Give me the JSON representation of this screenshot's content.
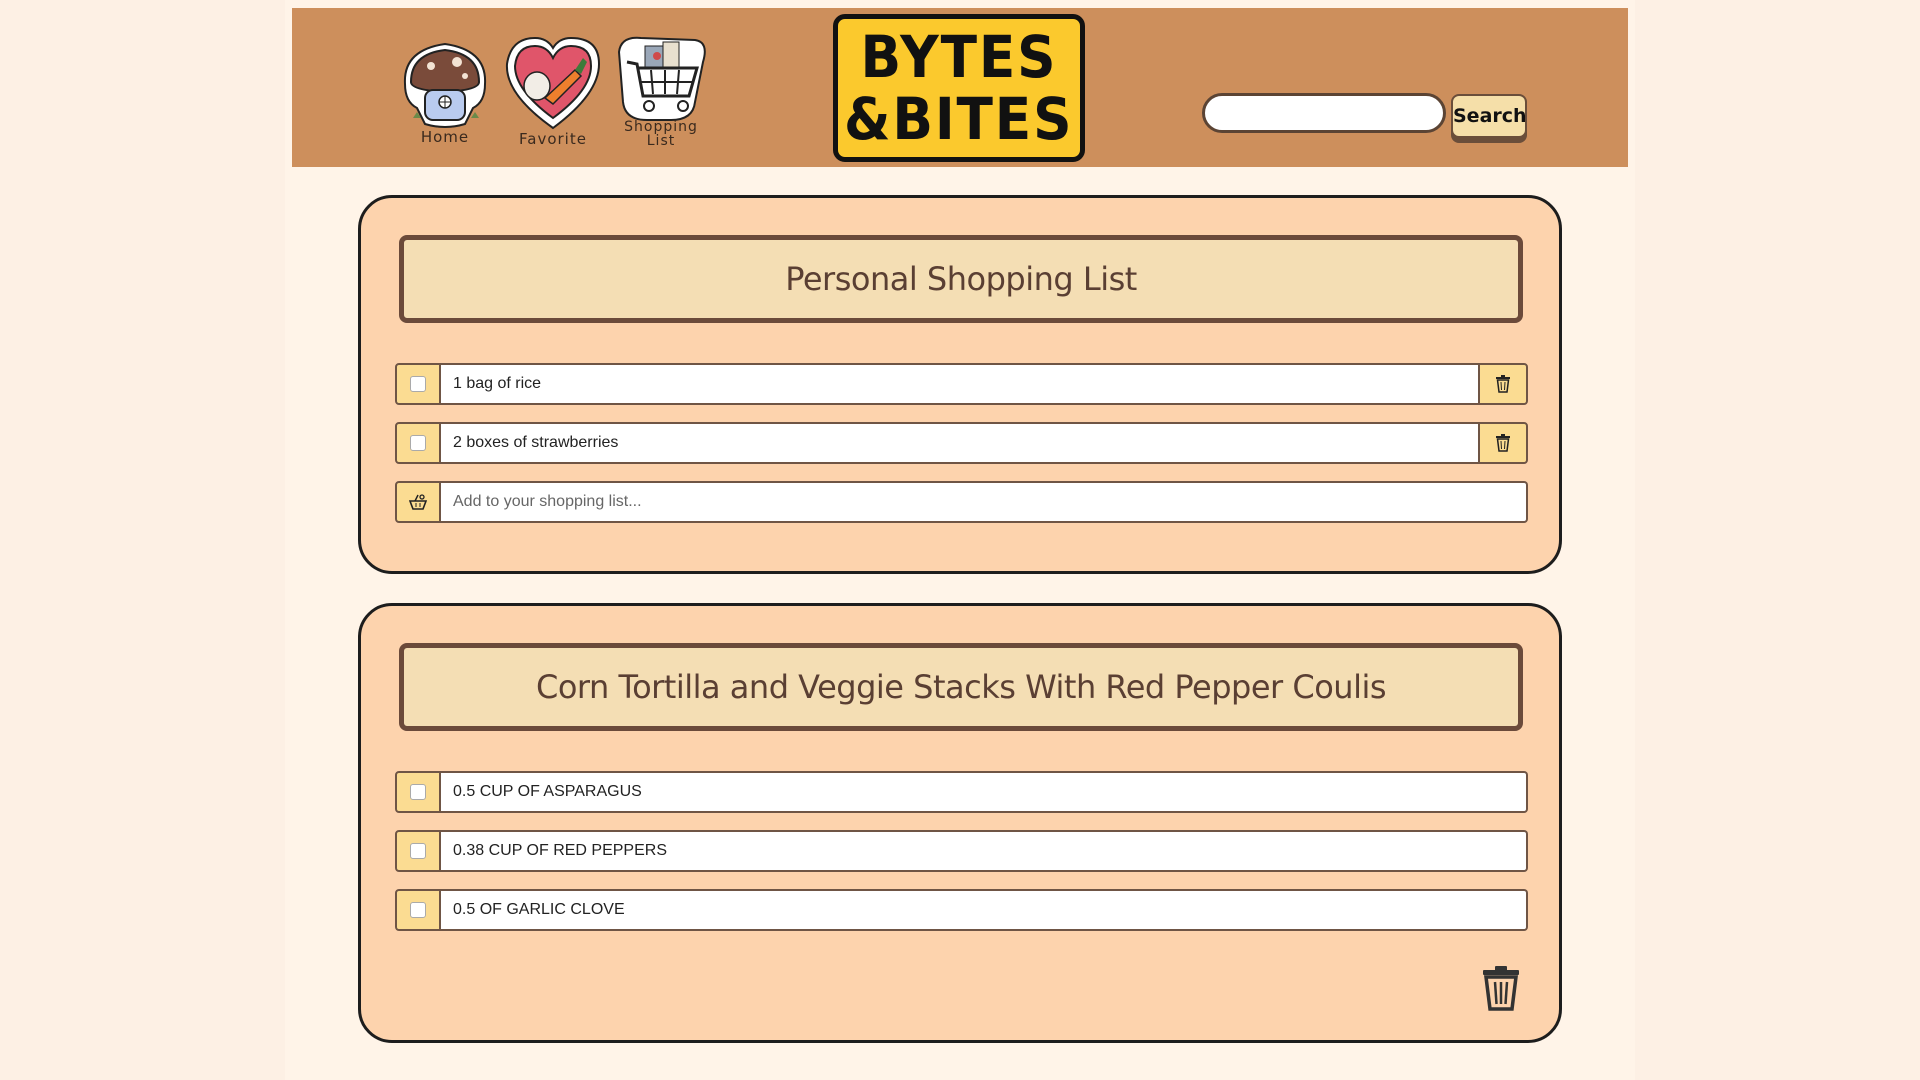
{
  "nav": {
    "home_label": "Home",
    "favorite_label": "Favorite",
    "shopping_label_line1": "Shopping",
    "shopping_label_line2": "List"
  },
  "logo": {
    "line1": "BYTES",
    "line2": "&BITES"
  },
  "search": {
    "value": "",
    "button_label": "Search"
  },
  "personal_list": {
    "title": "Personal Shopping List",
    "items": [
      {
        "text": "1 bag of rice",
        "checked": false
      },
      {
        "text": "2 boxes of strawberries",
        "checked": false
      }
    ],
    "add_placeholder": "Add to your shopping list..."
  },
  "recipe_list": {
    "title": "Corn Tortilla and Veggie Stacks With Red Pepper Coulis",
    "items": [
      {
        "text": "0.5 CUP OF ASPARAGUS",
        "checked": false
      },
      {
        "text": "0.38 CUP OF RED PEPPERS",
        "checked": false
      },
      {
        "text": "0.5  OF GARLIC CLOVE",
        "checked": false
      }
    ]
  },
  "colors": {
    "page_bg": "#fdf0e4",
    "header_bg": "#cd8f5c",
    "card_bg": "#fdd3ad",
    "title_bg": "#f4deb4",
    "title_text": "#5a3f33",
    "logo_bg": "#fbc92d",
    "cell_bg": "#fbdc92"
  },
  "icons": {
    "home": "mushroom-house-icon",
    "favorite": "heart-veggie-icon",
    "shopping": "shopping-cart-icon",
    "delete": "trash-icon",
    "add": "basket-icon"
  }
}
